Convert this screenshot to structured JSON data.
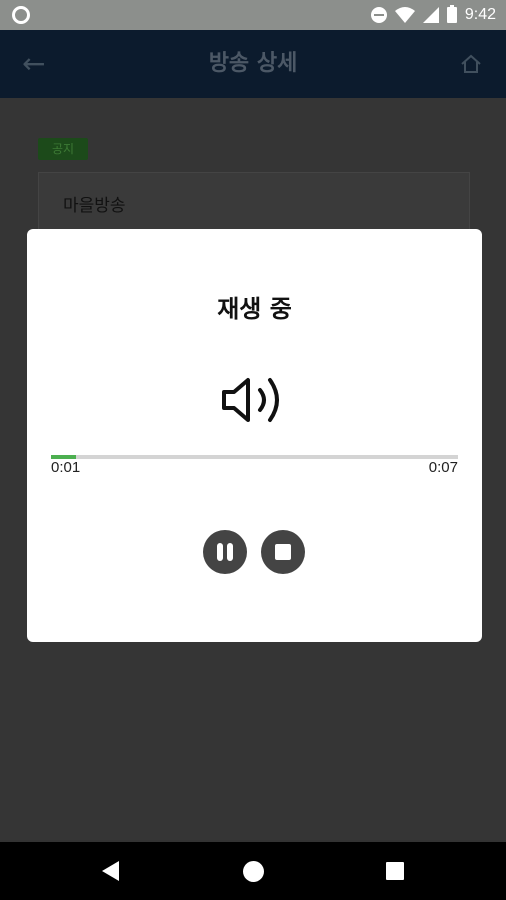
{
  "status_bar": {
    "time": "9:42",
    "icons": [
      "circle-icon",
      "dnd-icon",
      "wifi-icon",
      "signal-icon",
      "battery-icon"
    ]
  },
  "app_bar": {
    "title": "방송 상세",
    "back_icon": "arrow-left-icon",
    "home_icon": "home-icon"
  },
  "content": {
    "badge": "공지",
    "card_title": "마을방송"
  },
  "dialog": {
    "title": "재생 중",
    "speaker_icon": "speaker-icon",
    "progress": {
      "current": "0:01",
      "total": "0:07",
      "fraction": 0.0625,
      "color": "#4caf50"
    },
    "controls": [
      "pause-icon",
      "stop-icon"
    ]
  },
  "nav_bar": {
    "buttons": [
      "nav-back-icon",
      "nav-home-icon",
      "nav-recents-icon"
    ]
  }
}
